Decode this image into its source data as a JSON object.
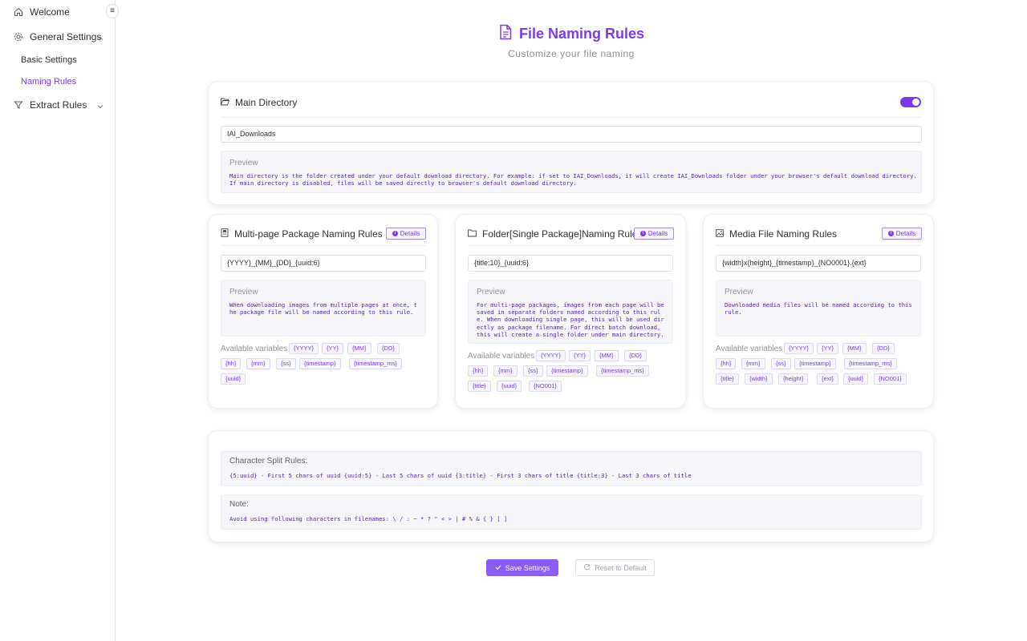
{
  "sidebar": {
    "collapse_glyph": "≡",
    "items": [
      {
        "label": "Welcome",
        "icon": "home-icon"
      },
      {
        "label": "General Settings",
        "icon": "gear-icon",
        "expanded": true
      },
      {
        "label": "Basic Settings"
      },
      {
        "label": "Naming Rules",
        "active": true
      },
      {
        "label": "Extract Rules",
        "icon": "filter-icon",
        "expanded": false
      }
    ]
  },
  "header": {
    "title": "File Naming Rules",
    "subtitle": "Customize your file naming",
    "icon": "document-icon"
  },
  "main_directory": {
    "title": "Main Directory",
    "enabled": true,
    "value": "IAI_Downloads",
    "preview_label": "Preview",
    "preview_text": "Main directory is the folder created under your default download directory. For example: if set to IAI_Downloads, it will create IAI_Downloads folder under your browser's default download directory.\nIf main directory is disabled, files will be saved directly to browser's default download directory."
  },
  "rules": [
    {
      "title": "Multi-page Package Naming Rules",
      "icon": "package-icon",
      "details_label": "Details",
      "value": "{YYYY}_{MM}_{DD}_{uuid:6}",
      "preview_label": "Preview",
      "preview_text": "When downloading images from multiple pages at once, t\nhe package file will be named according to this rule.",
      "vars_label": "Available variables",
      "vars": [
        "{YYYY}",
        "{YY}",
        "{MM}",
        "{DD}",
        "{hh}",
        "{mm}",
        "{ss}",
        "{timestamp}",
        "{timestamp_ms}",
        "{uuid}"
      ]
    },
    {
      "title": "Folder[Single Package]Naming Rules",
      "icon": "folder-icon",
      "details_label": "Details",
      "value": "{title:10}_{uuid:6}",
      "preview_label": "Preview",
      "preview_text": "For multi-page packages, images from each page will be\nsaved in separate folders named according to this rul\ne. When downloading single page, this will be used dir\nectly as package filename. For direct batch download,\nthis will create a single folder under main directory.",
      "vars_label": "Available variables",
      "vars": [
        "{YYYY}",
        "{YY}",
        "{MM}",
        "{DD}",
        "{hh}",
        "{mm}",
        "{ss}",
        "{timestamp}",
        "{timestamp_ms}",
        "{title}",
        "{uuid}",
        "{NO001}"
      ]
    },
    {
      "title": "Media File Naming Rules",
      "icon": "image-icon",
      "details_label": "Details",
      "value": "{width}x{height}_{timestamp}_{NO0001}.{ext}",
      "preview_label": "Preview",
      "preview_text": "Downloaded media files will be named according to this\nrule.",
      "vars_label": "Available variables",
      "vars": [
        "{YYYY}",
        "{YY}",
        "{MM}",
        "{DD}",
        "{hh}",
        "{mm}",
        "{ss}",
        "{timestamp}",
        "{timestamp_ms}",
        "{title}",
        "{width}",
        "{height}",
        "{ext}",
        "{uuid}",
        "{NO001}"
      ]
    }
  ],
  "split_rules": {
    "label": "Character Split Rules:",
    "text": "{5:uuid} - First 5 chars of uuid {uuid:5} - Last 5 chars of uuid {3:title} - First 3 chars of title {title:3} - Last 3 chars of title"
  },
  "note": {
    "label": "Note:",
    "text": "Avoid using following characters in filenames: \\ / : ~ * ? \" < > | # % & { } [ ]"
  },
  "actions": {
    "save_label": "Save Settings",
    "reset_label": "Reset to Default"
  },
  "colors": {
    "accent": "#7c3aed",
    "preview_text": "#5b21b6",
    "panel_bg": "#f5f5fa"
  }
}
